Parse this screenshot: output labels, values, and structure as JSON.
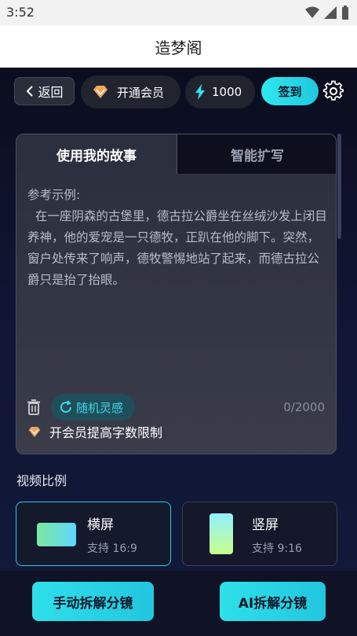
{
  "status_bar": {
    "time": "3:52"
  },
  "header": {
    "title": "造梦阁"
  },
  "topbar": {
    "back_label": "返回",
    "member_label": "开通会员",
    "points_value": "1000",
    "checkin_label": "签到"
  },
  "story_card": {
    "tabs": [
      {
        "label": "使用我的故事"
      },
      {
        "label": "智能扩写"
      }
    ],
    "example_title": "参考示例:",
    "example_text": "  在一座阴森的古堡里，德古拉公爵坐在丝绒沙发上闭目养神，他的爱宠是一只德牧，正趴在他的脚下。突然，窗户处传来了响声，德牧警惕地站了起来，而德古拉公爵只是抬了抬眼。",
    "inspire_label": "随机灵感",
    "char_count": "0/2000",
    "upsell_text": "开会员提高字数限制"
  },
  "aspect": {
    "section_label": "视频比例",
    "options": [
      {
        "title": "横屏",
        "sub": "支持 16:9"
      },
      {
        "title": "竖屏",
        "sub": "支持 9:16"
      }
    ]
  },
  "actions": {
    "manual_label": "手动拆解分镜",
    "ai_label": "AI拆解分镜"
  },
  "colors": {
    "accent": "#2fe7ee",
    "background": "#0b0d1e",
    "diamond": "#f0a65a"
  }
}
